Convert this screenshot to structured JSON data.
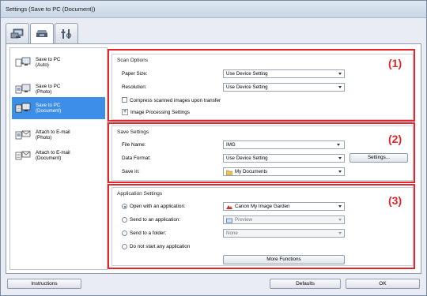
{
  "window": {
    "title": "Settings (Save to PC (Document))"
  },
  "tabs": [
    {
      "name": "scan-from-computer-icon"
    },
    {
      "name": "scan-from-operation-panel-icon"
    },
    {
      "name": "general-settings-icon"
    }
  ],
  "sidebar": {
    "items": [
      {
        "label_line1": "Save to PC",
        "label_line2": "(Auto)",
        "selected": false
      },
      {
        "label_line1": "Save to PC",
        "label_line2": "(Photo)",
        "selected": false
      },
      {
        "label_line1": "Save to PC",
        "label_line2": "(Document)",
        "selected": true
      },
      {
        "label_line1": "Attach to E-mail",
        "label_line2": "(Photo)",
        "selected": false
      },
      {
        "label_line1": "Attach to E-mail",
        "label_line2": "(Document)",
        "selected": false
      }
    ]
  },
  "scan_options": {
    "title": "Scan Options",
    "paper_size_label": "Paper Size:",
    "paper_size_value": "Use Device Setting",
    "resolution_label": "Resolution:",
    "resolution_value": "Use Device Setting",
    "compress_label": "Compress scanned images upon transfer",
    "image_processing_label": "Image Processing Settings",
    "marker": "(1)"
  },
  "save_settings": {
    "title": "Save Settings",
    "file_name_label": "File Name:",
    "file_name_value": "IMG",
    "data_format_label": "Data Format:",
    "data_format_value": "Use Device Setting",
    "settings_button": "Settings...",
    "save_in_label": "Save in:",
    "save_in_value": "My Documents",
    "marker": "(2)"
  },
  "application_settings": {
    "title": "Application Settings",
    "open_with_label": "Open with an application:",
    "open_with_value": "Canon My Image Garden",
    "send_to_app_label": "Send to an application:",
    "send_to_app_value": "Preview",
    "send_to_folder_label": "Send to a folder:",
    "send_to_folder_value": "None",
    "do_not_start_label": "Do not start any application",
    "more_functions_button": "More Functions",
    "marker": "(3)"
  },
  "footer": {
    "instructions_button": "Instructions",
    "defaults_button": "Defaults",
    "ok_button": "OK"
  },
  "colors": {
    "accent": "#3d8ee6",
    "highlight_box": "#e4262a"
  }
}
